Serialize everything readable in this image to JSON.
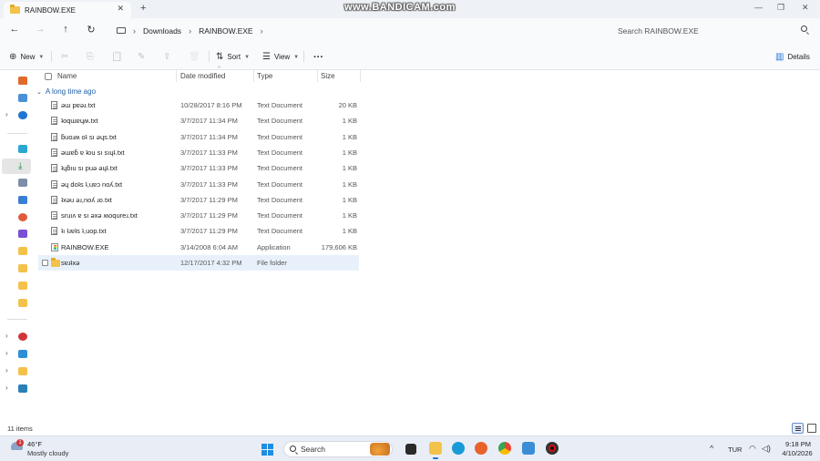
{
  "window": {
    "tab_title": "RAINBOW.EXE",
    "tab_close": "✕",
    "new_tab": "+",
    "watermark": "www.BANDICAM.com",
    "minimize": "—",
    "maximize": "❐",
    "close": "✕"
  },
  "address": {
    "back": "←",
    "forward": "→",
    "up": "↑",
    "refresh": "↻",
    "separator": "›",
    "breadcrumbs": [
      "Downloads",
      "RAINBOW.EXE"
    ],
    "more": "›",
    "search_placeholder": "Search RAINBOW.EXE"
  },
  "commands": {
    "new_label": "New",
    "new_icon": "⊕",
    "sort_label": "Sort",
    "sort_icon": "⇅",
    "view_label": "View",
    "view_icon": "☰",
    "more": "···",
    "details_label": "Details",
    "details_icon": "▥",
    "cut_icon": "✂",
    "copy_icon": "⎘",
    "paste_icon": "📋",
    "rename_icon": "✎",
    "share_icon": "⇪",
    "delete_icon": "🗑"
  },
  "columns": {
    "name": "Name",
    "date": "Date modified",
    "type": "Type",
    "size": "Size"
  },
  "group_label": "A long time ago",
  "files": [
    {
      "name": "ǝɯ pɐǝɹ.txt",
      "date": "10/28/2017 8:16 PM",
      "type": "Text Document",
      "size": "20 KB",
      "icon": "text-file-icon"
    },
    {
      "name": "ʇoqɯɐɥʍ.txt",
      "date": "3/7/2017 11:34 PM",
      "type": "Text Document",
      "size": "1 KB",
      "icon": "text-file-icon"
    },
    {
      "name": "ƃuoɹʍ oʇ sı ǝɥs.txt",
      "date": "3/7/2017 11:34 PM",
      "type": "Text Document",
      "size": "1 KB",
      "icon": "text-file-icon"
    },
    {
      "name": "ǝɯɐƃ ɐ ʇou sı sıɥʇ.txt",
      "date": "3/7/2017 11:33 PM",
      "type": "Text Document",
      "size": "1 KB",
      "icon": "text-file-icon"
    },
    {
      "name": "ʇɥƃıu sı puǝ ǝɥʇ.txt",
      "date": "3/7/2017 11:33 PM",
      "type": "Text Document",
      "size": "1 KB",
      "icon": "text-file-icon"
    },
    {
      "name": "ǝɥ doʇs ʇ,uɐɔ noʎ.txt",
      "date": "3/7/2017 11:33 PM",
      "type": "Text Document",
      "size": "1 KB",
      "icon": "text-file-icon"
    },
    {
      "name": "ʇxǝu ǝɹ,noʎ ɹo.txt",
      "date": "3/7/2017 11:29 PM",
      "type": "Text Document",
      "size": "1 KB",
      "icon": "text-file-icon"
    },
    {
      "name": "snɹıʌ ɐ sı ǝxǝ ʍoqureɹ.txt",
      "date": "3/7/2017 11:29 PM",
      "type": "Text Document",
      "size": "1 KB",
      "icon": "text-file-icon"
    },
    {
      "name": "ʇı ʇɹɐʇs ʇ,uop.txt",
      "date": "3/7/2017 11:29 PM",
      "type": "Text Document",
      "size": "1 KB",
      "icon": "text-file-icon"
    },
    {
      "name": "RAINBOW.EXE",
      "date": "3/14/2008 6:04 AM",
      "type": "Application",
      "size": "179,606 KB",
      "icon": "application-icon"
    },
    {
      "name": "sɐɹʇxǝ",
      "date": "12/17/2017 4:32 PM",
      "type": "File folder",
      "size": "",
      "icon": "folder-icon"
    }
  ],
  "status": {
    "item_count": "11 items"
  },
  "taskbar": {
    "weather_badge": "1",
    "weather_temp": "46°F",
    "weather_desc": "Mostly cloudy",
    "search_label": "Search",
    "tray_chevron": "^",
    "language": "TUR",
    "wifi_icon": "◠",
    "volume_icon": "◁)",
    "time": "9:18 PM",
    "date": "4/10/2026"
  },
  "colors": {
    "accent": "#1e74d6",
    "folder": "#f3c24b",
    "group_label": "#1f5fa8",
    "selected_row": "#e8f1fb"
  }
}
